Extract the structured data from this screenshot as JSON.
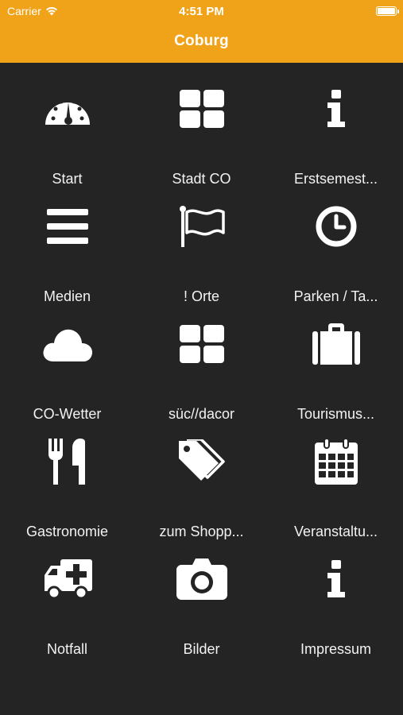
{
  "status_bar": {
    "carrier": "Carrier",
    "time": "4:51 PM"
  },
  "header": {
    "title": "Coburg",
    "accent_color": "#f0a318"
  },
  "tiles": [
    {
      "label": "Start",
      "icon": "dashboard-icon"
    },
    {
      "label": "Stadt CO",
      "icon": "grid-icon"
    },
    {
      "label": "Erstsemest...",
      "icon": "info-icon"
    },
    {
      "label": "Medien",
      "icon": "menu-icon"
    },
    {
      "label": "! Orte",
      "icon": "flag-icon"
    },
    {
      "label": "Parken / Ta...",
      "icon": "clock-icon"
    },
    {
      "label": "CO-Wetter",
      "icon": "cloud-icon"
    },
    {
      "label": "süc//dacor",
      "icon": "grid-icon"
    },
    {
      "label": "Tourismus...",
      "icon": "suitcase-icon"
    },
    {
      "label": "Gastronomie",
      "icon": "cutlery-icon"
    },
    {
      "label": "zum Shopp...",
      "icon": "tags-icon"
    },
    {
      "label": "Veranstaltu...",
      "icon": "calendar-icon"
    },
    {
      "label": "Notfall",
      "icon": "ambulance-icon"
    },
    {
      "label": "Bilder",
      "icon": "camera-icon"
    },
    {
      "label": "Impressum",
      "icon": "info-icon"
    }
  ]
}
